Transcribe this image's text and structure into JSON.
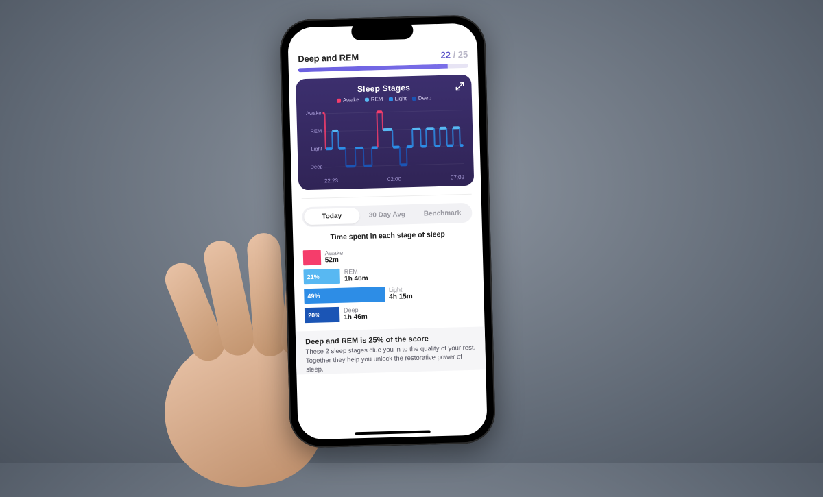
{
  "header": {
    "title": "Deep and REM",
    "score": "22",
    "score_max": "25",
    "progress_pct": 88
  },
  "colors": {
    "awake": "#F53D6B",
    "rem": "#58B8F2",
    "light": "#2D8DE6",
    "deep": "#1B55B5",
    "accent": "#6A5FE0"
  },
  "card": {
    "title": "Sleep Stages",
    "legend": [
      "Awake",
      "REM",
      "Light",
      "Deep"
    ],
    "x_ticks": [
      "22:23",
      "02:00",
      "07:02"
    ],
    "y_ticks": [
      "Awake",
      "REM",
      "Light",
      "Deep"
    ]
  },
  "tabs": [
    "Today",
    "30 Day Avg",
    "Benchmark"
  ],
  "active_tab": 0,
  "subheading": "Time spent in each stage of sleep",
  "stage_rows": [
    {
      "label": "Awake",
      "value": "52m",
      "pct_text": "",
      "width_pct": 9,
      "color": "#F53D6B"
    },
    {
      "label": "REM",
      "value": "1h 46m",
      "pct_text": "21%",
      "width_pct": 21,
      "color": "#58B8F2"
    },
    {
      "label": "Light",
      "value": "4h 15m",
      "pct_text": "49%",
      "width_pct": 49,
      "color": "#2D8DE6"
    },
    {
      "label": "Deep",
      "value": "1h 46m",
      "pct_text": "20%",
      "width_pct": 20,
      "color": "#1B55B5"
    }
  ],
  "footnote": {
    "heading": "Deep and REM is 25% of the score",
    "body": "These 2 sleep stages clue you in to the quality of your rest. Together they help you unlock the restorative power of sleep."
  },
  "chart_data": {
    "type": "step-timeline",
    "title": "Sleep Stages",
    "y_categories": [
      "Awake",
      "REM",
      "Light",
      "Deep"
    ],
    "x_range": [
      "22:23",
      "07:02"
    ],
    "x_ticks": [
      "22:23",
      "02:00",
      "07:02"
    ],
    "legend": [
      {
        "name": "Awake",
        "color": "#F53D6B"
      },
      {
        "name": "REM",
        "color": "#58B8F2"
      },
      {
        "name": "Light",
        "color": "#2D8DE6"
      },
      {
        "name": "Deep",
        "color": "#1B55B5"
      }
    ],
    "segments": [
      {
        "stage": "Awake",
        "start": "22:23",
        "end": "22:30"
      },
      {
        "stage": "Light",
        "start": "22:30",
        "end": "22:55"
      },
      {
        "stage": "REM",
        "start": "22:55",
        "end": "23:20"
      },
      {
        "stage": "Light",
        "start": "23:20",
        "end": "23:45"
      },
      {
        "stage": "Deep",
        "start": "23:45",
        "end": "00:20"
      },
      {
        "stage": "Light",
        "start": "00:20",
        "end": "00:50"
      },
      {
        "stage": "Deep",
        "start": "00:50",
        "end": "01:20"
      },
      {
        "stage": "Light",
        "start": "01:20",
        "end": "01:45"
      },
      {
        "stage": "Awake",
        "start": "01:45",
        "end": "02:05"
      },
      {
        "stage": "REM",
        "start": "02:05",
        "end": "02:40"
      },
      {
        "stage": "Light",
        "start": "02:40",
        "end": "03:05"
      },
      {
        "stage": "Deep",
        "start": "03:05",
        "end": "03:30"
      },
      {
        "stage": "Light",
        "start": "03:30",
        "end": "03:55"
      },
      {
        "stage": "REM",
        "start": "03:55",
        "end": "04:25"
      },
      {
        "stage": "Light",
        "start": "04:25",
        "end": "04:45"
      },
      {
        "stage": "REM",
        "start": "04:45",
        "end": "05:15"
      },
      {
        "stage": "Light",
        "start": "05:15",
        "end": "05:35"
      },
      {
        "stage": "REM",
        "start": "05:35",
        "end": "06:00"
      },
      {
        "stage": "Light",
        "start": "06:00",
        "end": "06:25"
      },
      {
        "stage": "REM",
        "start": "06:25",
        "end": "06:50"
      },
      {
        "stage": "Light",
        "start": "06:50",
        "end": "07:02"
      }
    ]
  }
}
